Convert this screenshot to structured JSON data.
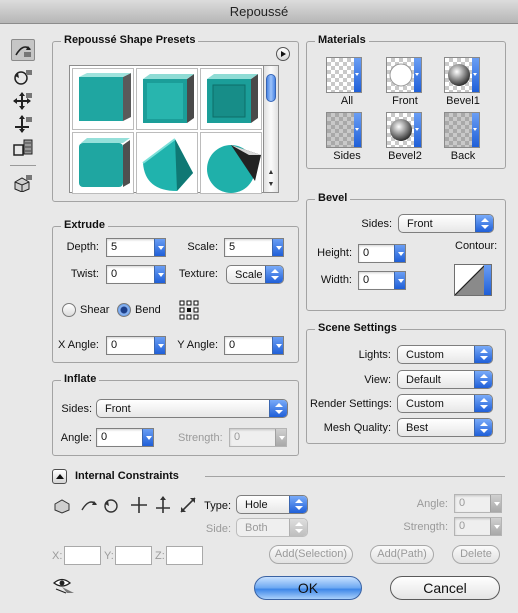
{
  "window": {
    "title": "Repoussé"
  },
  "tools": [
    "object-rotate-icon",
    "object-roll-icon",
    "object-pan-icon",
    "object-slide-icon",
    "object-scale-icon",
    "camera-icon"
  ],
  "presets": {
    "title": "Repoussé Shape Presets",
    "menu_icon": "flyout-arrow-icon",
    "items": [
      "cube-preset",
      "beveled-cube-preset",
      "inset-cube-preset",
      "rounded-cube-preset",
      "cone-preset",
      "sphere-cone-preset"
    ]
  },
  "materials": {
    "title": "Materials",
    "items": [
      {
        "label": "All",
        "swatch": "checker"
      },
      {
        "label": "Front",
        "swatch": "white-sphere"
      },
      {
        "label": "Bevel1",
        "swatch": "gray-sphere"
      },
      {
        "label": "Sides",
        "swatch": "checker-dark"
      },
      {
        "label": "Bevel2",
        "swatch": "gray-sphere"
      },
      {
        "label": "Back",
        "swatch": "checker-dark"
      }
    ]
  },
  "extrude": {
    "title": "Extrude",
    "depth_label": "Depth:",
    "depth": "5",
    "scale_label": "Scale:",
    "scale": "5",
    "twist_label": "Twist:",
    "twist": "0",
    "texture_label": "Texture:",
    "texture": "Scale",
    "shear_label": "Shear",
    "bend_label": "Bend",
    "mode": "Bend",
    "x_angle_label": "X Angle:",
    "x_angle": "0",
    "y_angle_label": "Y Angle:",
    "y_angle": "0"
  },
  "bevel": {
    "title": "Bevel",
    "sides_label": "Sides:",
    "sides": "Front",
    "height_label": "Height:",
    "height": "0",
    "width_label": "Width:",
    "width": "0",
    "contour_label": "Contour:"
  },
  "inflate": {
    "title": "Inflate",
    "sides_label": "Sides:",
    "sides": "Front",
    "angle_label": "Angle:",
    "angle": "0",
    "strength_label": "Strength:",
    "strength": "0"
  },
  "scene": {
    "title": "Scene Settings",
    "lights_label": "Lights:",
    "lights": "Custom",
    "view_label": "View:",
    "view": "Default",
    "render_label": "Render Settings:",
    "render": "Custom",
    "mesh_label": "Mesh Quality:",
    "mesh": "Best"
  },
  "constraints": {
    "title": "Internal Constraints",
    "type_label": "Type:",
    "type": "Hole",
    "side_label": "Side:",
    "side": "Both",
    "angle_label": "Angle:",
    "angle": "0",
    "strength_label": "Strength:",
    "strength": "0",
    "x_label": "X:",
    "y_label": "Y:",
    "z_label": "Z:",
    "add_selection": "Add(Selection)",
    "add_path": "Add(Path)",
    "delete": "Delete"
  },
  "footer": {
    "ok": "OK",
    "cancel": "Cancel",
    "preview_icon": "preview-eye-icon"
  }
}
